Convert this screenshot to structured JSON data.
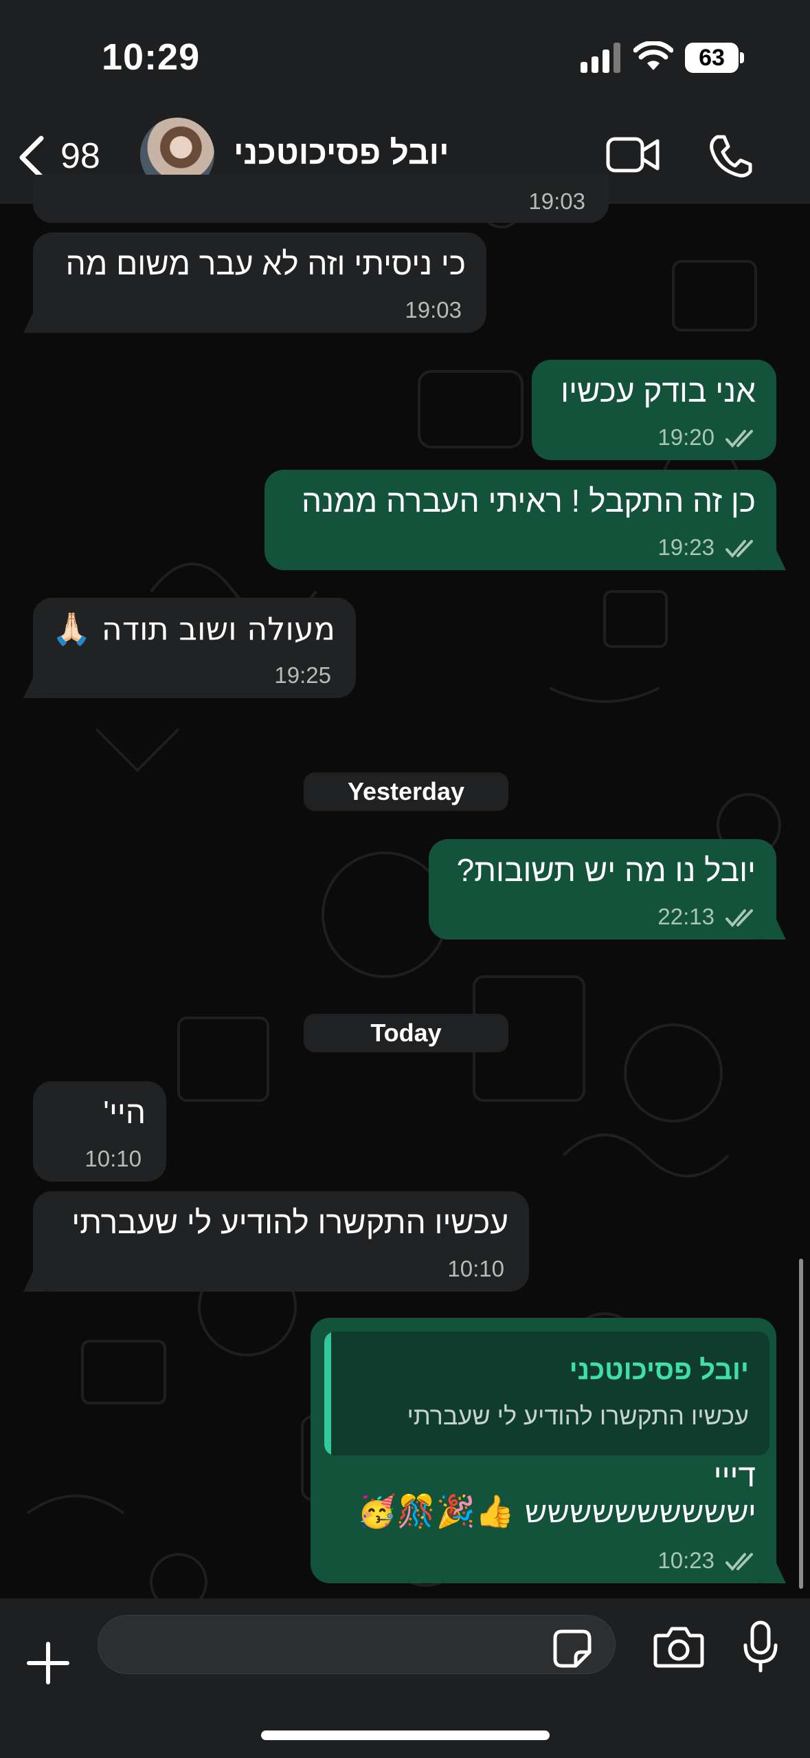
{
  "status_bar": {
    "time": "10:29",
    "battery": "63"
  },
  "header": {
    "unread_count": "98",
    "contact_name": "יובל פסיכוטכני"
  },
  "messages": [
    {
      "text": "",
      "time": "19:03"
    },
    {
      "text": "כי ניסיתי וזה לא עבר משום מה",
      "time": "19:03"
    },
    {
      "text": "אני בודק עכשיו",
      "time": "19:20"
    },
    {
      "text": "כן זה התקבל ! ראיתי העברה ממנה",
      "time": "19:23"
    },
    {
      "text": "מעולה ושוב תודה 🙏🏻",
      "time": "19:25"
    },
    {
      "text": "יובל נו מה יש תשובות?",
      "time": "22:13"
    },
    {
      "text": "היי'",
      "time": "10:10"
    },
    {
      "text": "עכשיו התקשרו להודיע לי שעברתי",
      "time": "10:10"
    }
  ],
  "day_separators": {
    "yesterday": "Yesterday",
    "today": "Today"
  },
  "reply_message": {
    "quote_name": "יובל פסיכוטכני",
    "quote_text": "עכשיו התקשרו להודיע לי שעברתי",
    "line1": "דייי",
    "line2": "ישששששששששש 👍🎉🎊🥳",
    "time": "10:23"
  },
  "input": {
    "placeholder": ""
  },
  "colors": {
    "incoming_bubble": "#202223",
    "outgoing_bubble": "#13523b",
    "accent": "#3ee0a7"
  },
  "icons": [
    "back-icon",
    "video-call-icon",
    "phone-icon",
    "plus-icon",
    "sticker-icon",
    "camera-icon",
    "mic-icon",
    "double-check-icon"
  ]
}
